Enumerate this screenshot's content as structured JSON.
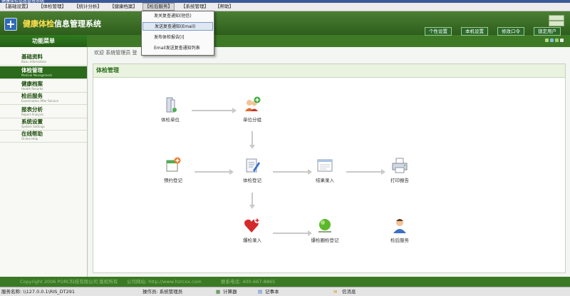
{
  "window": {
    "title": "健康体检信息管理系统"
  },
  "menubar": {
    "items": [
      "【基础设置】",
      "【体检管理】",
      "【统计分析】",
      "【健康档案】",
      "【检后服务】",
      "【系统管理】",
      "【帮助】"
    ]
  },
  "dropdown": {
    "items": [
      "发关复查通知(短信)",
      "发送复查通知(Email)",
      "发布体检报告[I]",
      "Email发送复查通知列表"
    ]
  },
  "header": {
    "logo_glyph": "+",
    "title_highlight": "健康体检",
    "title_rest": "信息管理系统",
    "buttons": [
      "个性设置",
      "本机设置",
      "修改口令",
      "锁定用户"
    ]
  },
  "sidebar": {
    "heading": "功能菜单",
    "items": [
      {
        "cn": "基础资料",
        "en": "Basic Information"
      },
      {
        "cn": "体检管理",
        "en": "Medical Management"
      },
      {
        "cn": "健康档案",
        "en": "Health Records"
      },
      {
        "cn": "检后服务",
        "en": "Examination After Service"
      },
      {
        "cn": "报表分析",
        "en": "Report Analysis"
      },
      {
        "cn": "系统设置",
        "en": "System Settings"
      },
      {
        "cn": "在线帮助",
        "en": "Online Help"
      }
    ]
  },
  "breadcrumb": "欢迎 系统管理员 登",
  "panel": {
    "title": "体检管理",
    "nodes": {
      "unit": "体检单位",
      "group": "单位分组",
      "booking": "预约登记",
      "register": "体检登记",
      "result": "结果录入",
      "print": "打印报告",
      "positive": "爆检录入",
      "reexam": "爆检圈检登记",
      "service": "检后服务"
    }
  },
  "footer": {
    "copyright": "Copyright 2006 PORC科技有限公司 版权所有",
    "website": "公司网站: http://www.hzrcxx.com",
    "phone": "联系电话: 400-667-8865"
  },
  "statusbar": {
    "server": "服务名称: \\\\127.0.0.1\\RIS_DT291",
    "operator": "操作员: 系统管理员",
    "calculator": "计算器",
    "notepad": "记事本",
    "messages": "信消息"
  },
  "colors": {
    "accent": "#2c6a1c",
    "title_highlight": "#ffe14d",
    "menu_select": "#dfe7f2"
  }
}
